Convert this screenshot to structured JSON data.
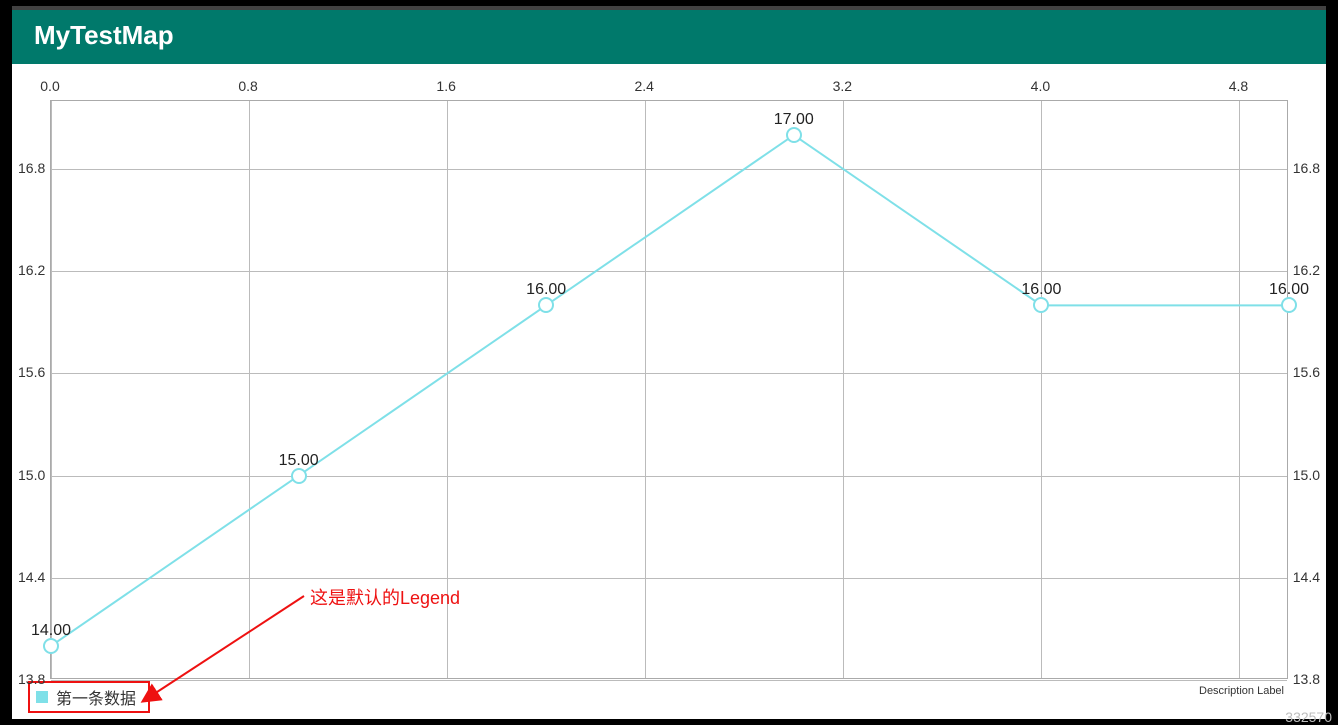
{
  "app": {
    "title": "MyTestMap"
  },
  "chart_data": {
    "type": "line",
    "x": [
      0,
      1,
      2,
      3,
      4,
      5
    ],
    "values": [
      14.0,
      15.0,
      16.0,
      17.0,
      16.0,
      16.0
    ],
    "point_labels": [
      "14.00",
      "15.00",
      "16.00",
      "17.00",
      "16.00",
      "16.00"
    ],
    "x_ticks": [
      0.0,
      0.8,
      1.6,
      2.4,
      3.2,
      4.0,
      4.8
    ],
    "x_tick_labels": [
      "0.0",
      "0.8",
      "1.6",
      "2.4",
      "3.2",
      "4.0",
      "4.8"
    ],
    "y_ticks": [
      13.8,
      14.4,
      15.0,
      15.6,
      16.2,
      16.8
    ],
    "y_tick_labels": [
      "13.8",
      "14.4",
      "15.0",
      "15.6",
      "16.2",
      "16.8"
    ],
    "xlim": [
      0.0,
      5.0
    ],
    "ylim": [
      13.8,
      17.2
    ],
    "series_name": "第一条数据",
    "line_color": "#7fe0e8",
    "title": "",
    "xlabel": "",
    "ylabel": ""
  },
  "legend": {
    "label": "第一条数据"
  },
  "description_label": "Description Label",
  "annotation": {
    "text": "这是默认的Legend"
  },
  "watermark": "332570"
}
